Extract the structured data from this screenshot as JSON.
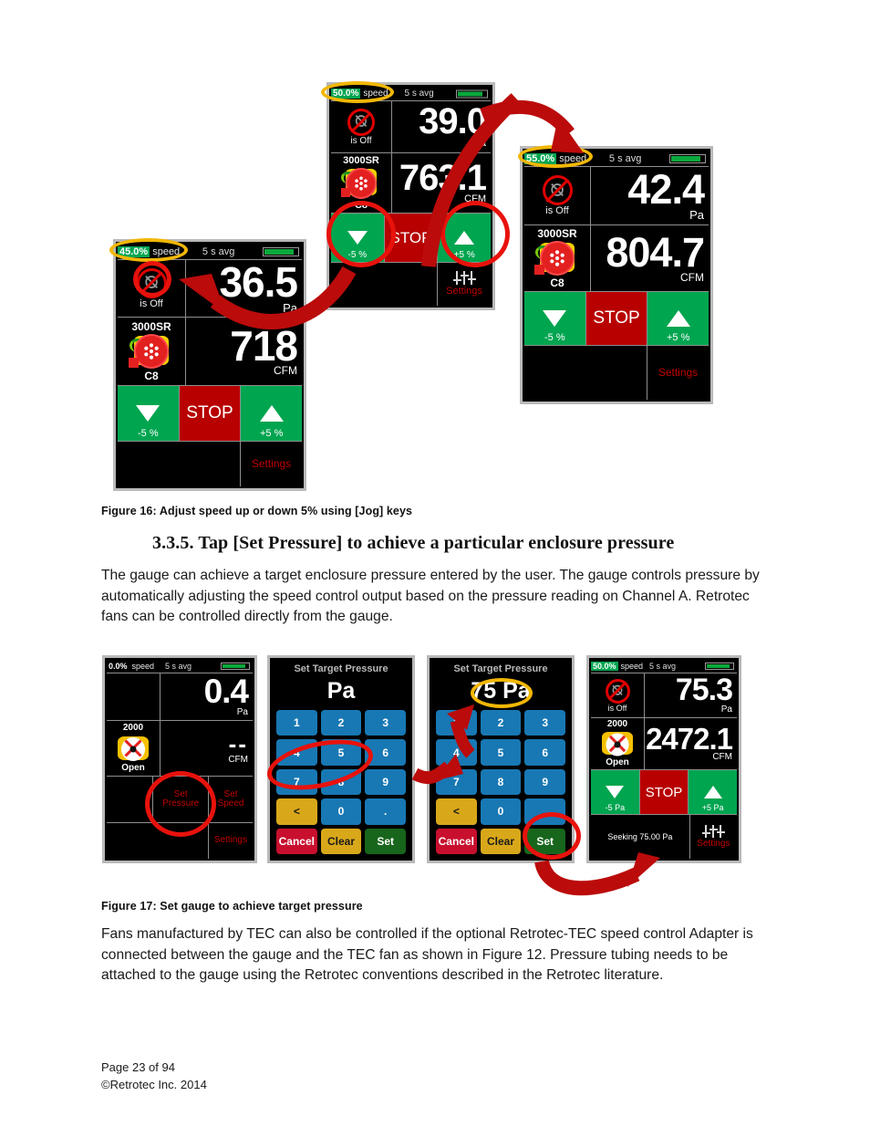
{
  "document": {
    "section_heading": "3.3.5.  Tap [Set Pressure] to achieve a particular enclosure pressure",
    "figure16_caption": "Figure 16:  Adjust speed up or down 5% using [Jog] keys",
    "figure17_caption": "Figure 17:  Set gauge to achieve target pressure",
    "paragraph1": "The gauge can achieve a target enclosure pressure entered by the user.  The gauge controls pressure by automatically adjusting the speed control output based on the pressure reading on Channel A.  Retrotec fans can be controlled directly from the gauge.",
    "paragraph2": "Fans manufactured by TEC can also be controlled if the optional Retrotec-TEC speed control Adapter is connected between the gauge and the TEC fan as shown in Figure 12.  Pressure tubing needs to be attached to the gauge using the Retrotec conventions described in the Retrotec literature.",
    "footer_page": "Page 23 of 94",
    "footer_copyright": "©Retrotec Inc. 2014"
  },
  "colors": {
    "green_button": "#00a550",
    "red_button": "#b80000",
    "speed_badge": "#00a550",
    "settings_text": "#c00000",
    "annotation_yellow": "#f2b705",
    "annotation_red": "#e8120c",
    "keypad_blue": "#1878b4",
    "keypad_gold": "#d9a81a",
    "keypad_crimson": "#c8102e",
    "keypad_green": "#17661c"
  },
  "figure16": {
    "gauges": [
      {
        "id": "gauge-45",
        "speed": "45.0%",
        "speed_label": "speed",
        "avg_label": "5 s avg",
        "fan_status": "is Off",
        "fan_model": "3000SR",
        "fan_range": "C8",
        "pressure_value": "36.5",
        "pressure_unit": "Pa",
        "flow_value": "718",
        "flow_unit": "CFM",
        "jog_down": "-5 %",
        "stop": "STOP",
        "jog_up": "+5 %",
        "settings": "Settings"
      },
      {
        "id": "gauge-50",
        "speed": "50.0%",
        "speed_label": "speed",
        "avg_label": "5 s avg",
        "fan_status": "is Off",
        "fan_model": "3000SR",
        "fan_range": "C8",
        "pressure_value": "39.0",
        "pressure_unit": "Pa",
        "flow_value": "763.1",
        "flow_unit": "CFM",
        "jog_down": "-5 %",
        "stop": "STOP",
        "jog_up": "+5 %",
        "settings": "Settings"
      },
      {
        "id": "gauge-55",
        "speed": "55.0%",
        "speed_label": "speed",
        "avg_label": "5 s avg",
        "fan_status": "is Off",
        "fan_model": "3000SR",
        "fan_range": "C8",
        "pressure_value": "42.4",
        "pressure_unit": "Pa",
        "flow_value": "804.7",
        "flow_unit": "CFM",
        "jog_down": "-5 %",
        "stop": "STOP",
        "jog_up": "+5 %",
        "settings": "Settings"
      }
    ]
  },
  "figure17": {
    "gauge_start": {
      "id": "gauge-idle",
      "speed": "0.0%",
      "speed_label": "speed",
      "avg_label": "5 s avg",
      "fan_model": "2000",
      "fan_range": "Open",
      "pressure_value": "0.4",
      "pressure_unit": "Pa",
      "flow_value": "--",
      "flow_unit": "CFM",
      "set_pressure": "Set\nPressure",
      "set_speed": "Set\nSpeed",
      "settings": "Settings"
    },
    "keypad_empty": {
      "id": "keypad-empty",
      "title": "Set Target Pressure",
      "value": "Pa",
      "keys": [
        "1",
        "2",
        "3",
        "4",
        "5",
        "6",
        "7",
        "8",
        "9",
        "<",
        "0",
        "."
      ],
      "cancel": "Cancel",
      "clear": "Clear",
      "set": "Set"
    },
    "keypad_filled": {
      "id": "keypad-filled",
      "title": "Set Target Pressure",
      "value": "75 Pa",
      "keys": [
        "1",
        "2",
        "3",
        "4",
        "5",
        "6",
        "7",
        "8",
        "9",
        "<",
        "0",
        "."
      ],
      "cancel": "Cancel",
      "clear": "Clear",
      "set": "Set"
    },
    "gauge_result": {
      "id": "gauge-seeking",
      "speed": "50.0%",
      "speed_label": "speed",
      "avg_label": "5 s avg",
      "fan_status": "is Off",
      "fan_model": "2000",
      "fan_range": "Open",
      "pressure_value": "75.3",
      "pressure_unit": "Pa",
      "flow_value": "2472.1",
      "flow_unit": "CFM",
      "jog_down": "-5 Pa",
      "stop": "STOP",
      "jog_up": "+5 Pa",
      "status": "Seeking 75.00 Pa",
      "settings": "Settings"
    }
  }
}
